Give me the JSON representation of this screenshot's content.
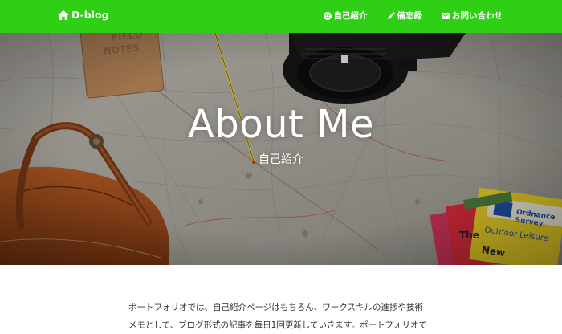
{
  "brand": {
    "label": "D-blog",
    "icon": "home-icon"
  },
  "nav": [
    {
      "label": "自己紹介",
      "icon": "smile-icon"
    },
    {
      "label": "備忘録",
      "icon": "pen-icon"
    },
    {
      "label": "お問い合わせ",
      "icon": "envelope-icon"
    }
  ],
  "hero": {
    "title": "About Me",
    "subtitle": "自己紹介"
  },
  "content": {
    "intro_line1": "ポートフォリオでは、自己紹介ページはもちろん、ワークスキルの進捗や技術",
    "intro_line2": "メモとして、ブログ形式の記事を毎日1回更新していきます。ポートフォリオで"
  },
  "colors": {
    "navbar": "#2ecf14",
    "text": "#333333",
    "hero_text": "#ffffff"
  }
}
